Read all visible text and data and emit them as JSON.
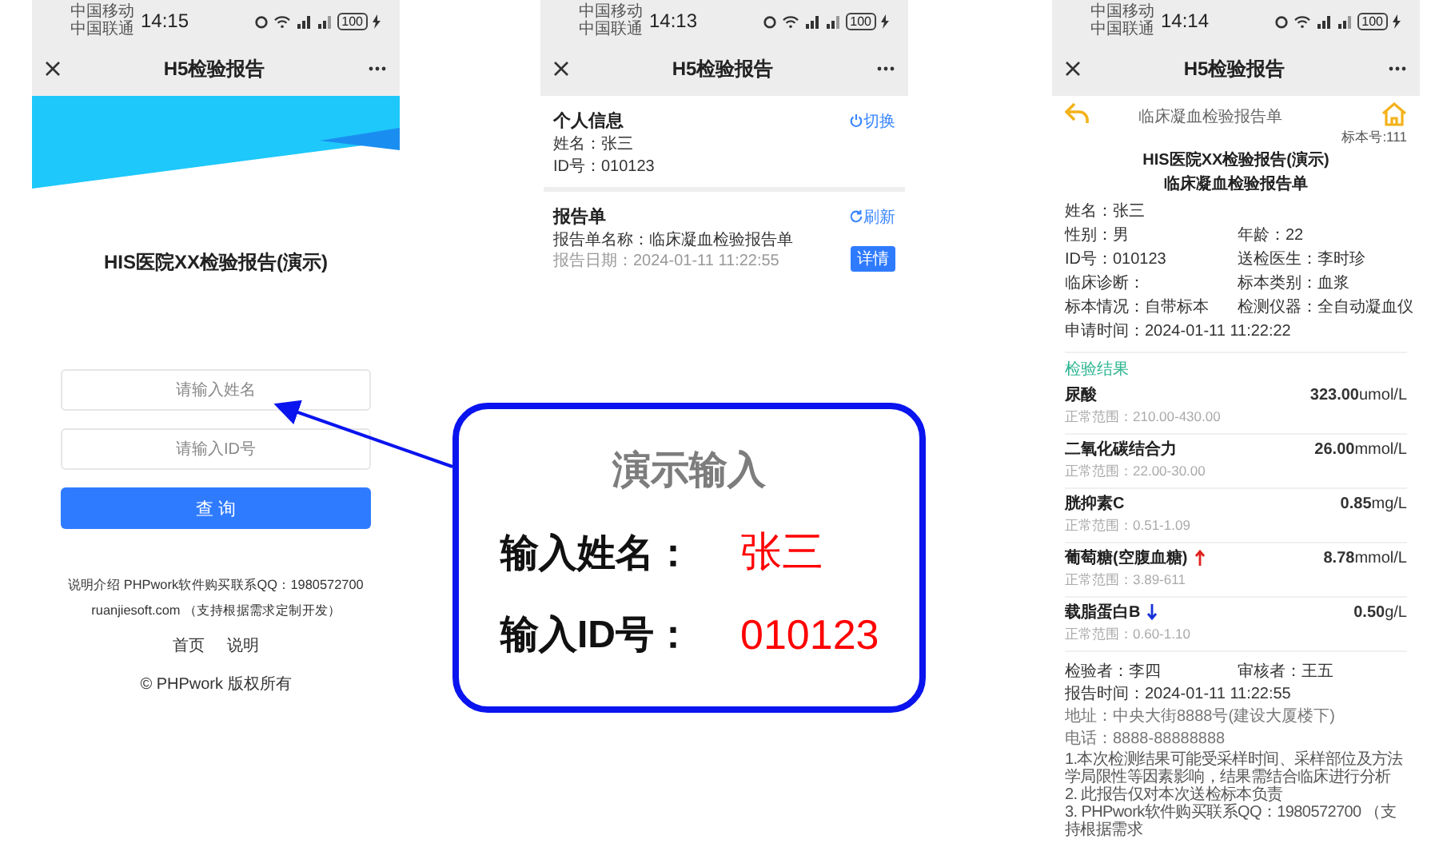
{
  "login_screen": {
    "status_bar": {
      "carriers": [
        "中国移动",
        "中国联通"
      ],
      "time": "14:15",
      "battery": "100"
    },
    "nav_bar": {
      "title": "H5检验报告"
    },
    "heading": "HIS医院XX检验报告(演示)",
    "name_field": {
      "placeholder": "请输入姓名"
    },
    "id_field": {
      "placeholder": "请输入ID号"
    },
    "query_button": "查 询",
    "footer_lines": [
      "说明介绍 PHPwork软件购买联系QQ：1980572700",
      "ruanjiesoft.com （支持根据需求定制开发）"
    ],
    "footer_links": [
      "首页",
      "说明"
    ],
    "copyright": "© PHPwork 版权所有"
  },
  "report_list_screen": {
    "status_bar": {
      "carriers": [
        "中国移动",
        "中国联通"
      ],
      "time": "14:13",
      "battery": "100"
    },
    "nav_bar": {
      "title": "H5检验报告"
    },
    "personal_info": {
      "title": "个人信息",
      "action": "切换",
      "lines": [
        "姓名：张三",
        "ID号：010123"
      ]
    },
    "reports": {
      "title": "报告单",
      "action": "刷新",
      "items": [
        {
          "name": "报告单名称：临床凝血检验报告单",
          "date": "报告日期：2024-01-11 11:22:55",
          "button": "详情"
        }
      ]
    }
  },
  "report_detail_screen": {
    "status_bar": {
      "carriers": [
        "中国移动",
        "中国联通"
      ],
      "time": "14:14",
      "battery": "100"
    },
    "nav_bar": {
      "title": "H5检验报告"
    },
    "page_title": "临床凝血检验报告单",
    "sample_number": "标本号:111",
    "hospital_title": "HIS医院XX检验报告(演示)",
    "report_title": "临床凝血检验报告单",
    "info_rows": [
      [
        "姓名：张三"
      ],
      [
        "性别：男",
        "年龄：22"
      ],
      [
        "ID号：010123",
        "送检医生：李时珍"
      ],
      [
        "临床诊断：",
        "标本类别：血浆"
      ],
      [
        "标本情况：自带标本",
        "检测仪器：全自动凝血仪"
      ],
      [
        "申请时间：2024-01-11 11:22:22"
      ]
    ],
    "results_title": "检验结果",
    "results": [
      {
        "name": "尿酸",
        "above_range": false,
        "below_range": false,
        "value": "323.00",
        "unit": "umol/L",
        "range": "正常范围：210.00-430.00"
      },
      {
        "name": "二氧化碳结合力",
        "above_range": false,
        "below_range": false,
        "value": "26.00",
        "unit": "mmol/L",
        "range": "正常范围：22.00-30.00"
      },
      {
        "name": "胱抑素C",
        "above_range": false,
        "below_range": false,
        "value": "0.85",
        "unit": "mg/L",
        "range": "正常范围：0.51-1.09"
      },
      {
        "name": "葡萄糖(空腹血糖)",
        "above_range": true,
        "below_range": false,
        "value": "8.78",
        "unit": "mmol/L",
        "range": "正常范围：3.89-611"
      },
      {
        "name": "载脂蛋白B",
        "above_range": false,
        "below_range": true,
        "value": "0.50",
        "unit": "g/L",
        "range": "正常范围：0.60-1.10"
      }
    ],
    "signers": [
      "检验者：李四",
      "审核者：王五"
    ],
    "report_time": "报告时间：2024-01-11 11:22:55",
    "contact_lines": [
      "地址：中央大街8888号(建设大厦楼下)",
      "电话：8888-88888888"
    ],
    "notes": [
      "1.本次检测结果可能受采样时间、采样部位及方法学局限性等因素影响，结果需结合临床进行分析",
      "2. 此报告仅对本次送检标本负责",
      "3. PHPwork软件购买联系QQ：1980572700 （支持根据需求"
    ]
  },
  "callout": {
    "title": "演示输入",
    "rows": [
      {
        "label": "输入姓名：",
        "value": "张三"
      },
      {
        "label": "输入ID号：",
        "value": "010123"
      }
    ]
  }
}
